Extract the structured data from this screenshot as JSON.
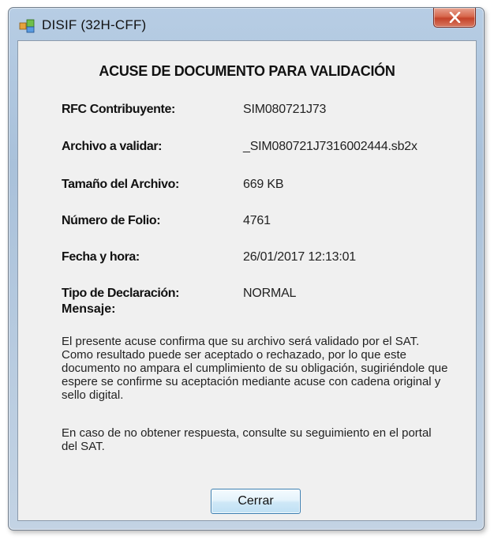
{
  "window": {
    "title": "DISIF (32H-CFF)"
  },
  "dialog": {
    "heading": "ACUSE DE DOCUMENTO PARA VALIDACIÓN",
    "fields": [
      {
        "label": "RFC Contribuyente:",
        "value": "SIM080721J73"
      },
      {
        "label": "Archivo a validar:",
        "value": "_SIM080721J7316002444.sb2x"
      },
      {
        "label": "Tamaño del Archivo:",
        "value": "669 KB"
      },
      {
        "label": "Número de Folio:",
        "value": "4761"
      },
      {
        "label": "Fecha y hora:",
        "value": "26/01/2017 12:13:01"
      },
      {
        "label": "Tipo de Declaración:",
        "value": "NORMAL"
      }
    ],
    "message_label": "Mensaje:",
    "message_paragraph_1": "El presente acuse confirma que su archivo será validado por el SAT. Como resultado puede ser aceptado o rechazado, por lo que este documento no ampara el cumplimiento de su obligación, sugiriéndole que espere se confirme su aceptación mediante acuse con cadena original y sello digital.",
    "message_paragraph_2": "En caso de no obtener respuesta, consulte su seguimiento en el portal del SAT.",
    "close_button_label": "Cerrar"
  }
}
